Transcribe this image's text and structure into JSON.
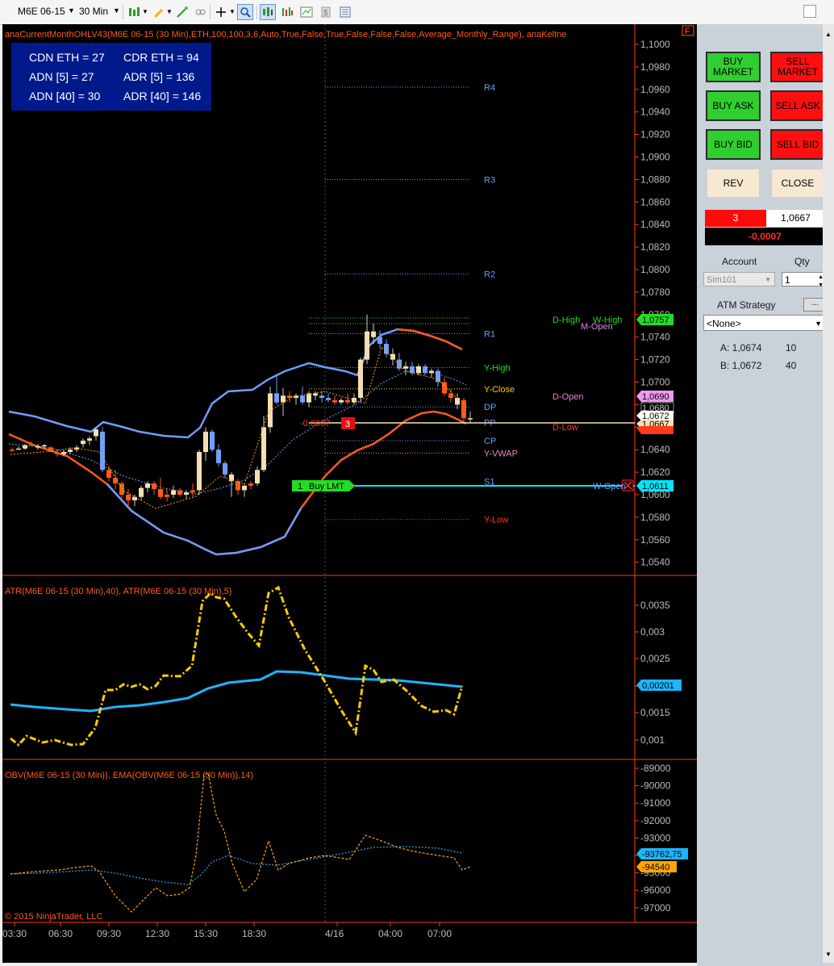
{
  "toolbar": {
    "instrument": "M6E 06-15",
    "interval": "30 Min",
    "icons": [
      "bars-icon",
      "pencil-icon",
      "wand-icon",
      "crosshair-icon",
      "zoom-icon",
      "data-box-icon",
      "properties-icon",
      "chart-trader-icon",
      "dollar-icon",
      "template-icon"
    ]
  },
  "chart": {
    "indicator_title": "anaCurrentMonthOHLV43(M6E 06-15 (30 Min),ETH,100,100,3,6,Auto,True,False,True,False,False,False,Average_Monthly_Range), anaKeltne",
    "info_box": {
      "cdn_eth": "CDN ETH = 27",
      "cdr_eth": "CDR ETH = 94",
      "adn5": "ADN [5] = 27",
      "adr5": "ADR [5] = 136",
      "adn40": "ADN [40] = 30",
      "adr40": "ADR [40] = 146"
    },
    "price_axis": [
      "1,1000",
      "1,0980",
      "1,0960",
      "1,0940",
      "1,0920",
      "1,0900",
      "1,0880",
      "1,0860",
      "1,0840",
      "1,0820",
      "1,0800",
      "1,0780",
      "1,0760",
      "1,0740",
      "1,0720",
      "1,0700",
      "1,0680",
      "1,0660",
      "1,0640",
      "1,0620",
      "1,0600",
      "1,0580",
      "1,0560",
      "1,0540"
    ],
    "pivot_labels": [
      "R4",
      "R3",
      "R2",
      "R1",
      "Y-High",
      "Y-Close",
      "DP",
      "PP",
      "CP",
      "Y-VWAP",
      "S1",
      "Y-Low"
    ],
    "right_labels": [
      "D-High",
      "W-High",
      "M-Open",
      "D-Open",
      "D-Low",
      "W-Open"
    ],
    "price_markers": {
      "high": "1,0757",
      "dopen": "1,0690",
      "last1": "1,0680",
      "last2": "1,0672",
      "last3": "1,0667",
      "last4": "1,0663",
      "s1": "1,0611"
    },
    "position_line": {
      "pnl": "-0,0007",
      "qty": "3"
    },
    "order_line": {
      "qty": "1",
      "type": "Buy LMT"
    },
    "pane2_title": "ATR(M6E 06-15 (30 Min),40), ATR(M6E 06-15 (30 Min),5)",
    "pane2_axis": [
      "0,0035",
      "0,003",
      "0,0025",
      "0,002",
      "0,0015",
      "0,001"
    ],
    "pane2_marker": "0,00201",
    "pane3_title": "OBV(M6E 06-15 (30 Min)), EMA(OBV(M6E 06-15 (30 Min)),14)",
    "pane3_axis": [
      "-89000",
      "-90000",
      "-91000",
      "-92000",
      "-93000",
      "-94000",
      "-95000",
      "-96000",
      "-97000"
    ],
    "pane3_marker1": "-93762,75",
    "pane3_marker2": "-94540",
    "time_axis": [
      "03:30",
      "06:30",
      "09:30",
      "12:30",
      "15:30",
      "18:30",
      "4/16",
      "04:00",
      "07:00"
    ],
    "copyright": "© 2015 NinjaTrader, LLC",
    "flag": "F"
  },
  "panel": {
    "buy_market": "BUY\nMARKET",
    "sell_market": "SELL\nMARKET",
    "buy_ask": "BUY ASK",
    "sell_ask": "SELL ASK",
    "buy_bid": "BUY BID",
    "sell_bid": "SELL BID",
    "rev": "REV",
    "close": "CLOSE",
    "position_qty": "3",
    "position_price": "1,0667",
    "position_pnl": "-0,0007",
    "account_label": "Account",
    "qty_label": "Qty",
    "account_value": "Sim101",
    "qty_value": "1",
    "atm_label": "ATM Strategy",
    "atm_value": "<None>",
    "ask_label": "A: 1,0674",
    "ask_size": "10",
    "bid_label": "B: 1,0672",
    "bid_size": "40"
  },
  "colors": {
    "price_up": "#f5deb3",
    "price_down_red": "#ff5a1a",
    "price_down_blue": "#6fa0ff",
    "keltner_upper": "#6f9cff",
    "keltner_lower": "#ff5a1a",
    "atr40": "#1eb4ff",
    "atr5": "#ffcc00",
    "s1_line": "#00e5ff"
  }
}
